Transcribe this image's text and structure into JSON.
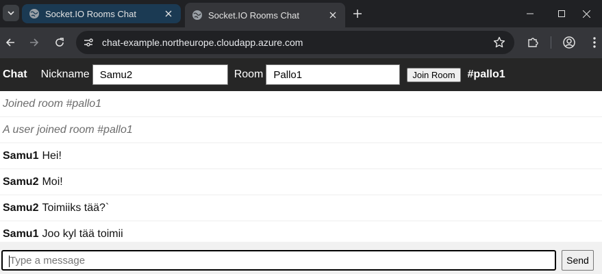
{
  "browser": {
    "tabs": [
      {
        "title": "Socket.IO Rooms Chat",
        "state": "inactive"
      },
      {
        "title": "Socket.IO Rooms Chat",
        "state": "active"
      }
    ],
    "url": "chat-example.northeurope.cloudapp.azure.com"
  },
  "app": {
    "brand": "Chat",
    "nickname_label": "Nickname",
    "nickname_value": "Samu2",
    "room_label": "Room",
    "room_value": "Pallo1",
    "join_button": "Join Room",
    "current_room": "#pallo1"
  },
  "messages": [
    {
      "type": "system",
      "text": "Joined room #pallo1"
    },
    {
      "type": "system",
      "text": "A user joined room #pallo1"
    },
    {
      "type": "chat",
      "author": "Samu1",
      "text": "Hei!"
    },
    {
      "type": "chat",
      "author": "Samu2",
      "text": "Moi!"
    },
    {
      "type": "chat",
      "author": "Samu2",
      "text": "Toimiiks tää?`"
    },
    {
      "type": "chat",
      "author": "Samu1",
      "text": "Joo kyl tää toimii"
    }
  ],
  "composer": {
    "placeholder": "Type a message",
    "send_button": "Send"
  },
  "colors": {
    "app_header_bg": "#262626",
    "browser_frame": "#202124",
    "toolbar": "#35363a"
  }
}
